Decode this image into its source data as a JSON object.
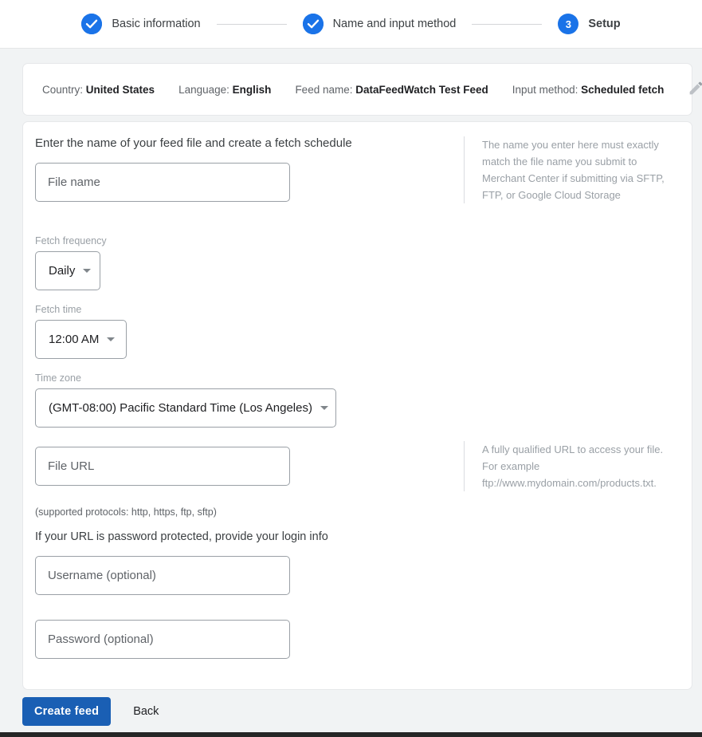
{
  "stepper": {
    "steps": [
      {
        "label": "Basic information",
        "state": "complete",
        "icon": "check-circle-icon",
        "number": "1"
      },
      {
        "label": "Name and input method",
        "state": "complete",
        "icon": "check-circle-icon",
        "number": "2"
      },
      {
        "label": "Setup",
        "state": "active",
        "icon": "number-badge",
        "number": "3"
      }
    ],
    "accent_color": "#1a73e8"
  },
  "summary": {
    "items": [
      {
        "label": "Country:",
        "value": "United States"
      },
      {
        "label": "Language:",
        "value": "English"
      },
      {
        "label": "Feed name:",
        "value": "DataFeedWatch Test Feed"
      },
      {
        "label": "Input method:",
        "value": "Scheduled fetch"
      }
    ],
    "edit_icon": "pencil-icon"
  },
  "form": {
    "title": "Enter the name of your feed file and create a fetch schedule",
    "file_name": {
      "placeholder": "File name",
      "value": ""
    },
    "file_name_hint": "The name you enter here must exactly match the file name you submit to Merchant Center if submitting via SFTP, FTP, or Google Cloud Storage",
    "fetch_frequency": {
      "label": "Fetch frequency",
      "value": "Daily"
    },
    "fetch_time": {
      "label": "Fetch time",
      "value": "12:00 AM"
    },
    "time_zone": {
      "label": "Time zone",
      "value": "(GMT-08:00) Pacific Standard Time (Los Angeles)"
    },
    "file_url": {
      "placeholder": "File URL",
      "value": ""
    },
    "file_url_hint": "A fully qualified URL to access your file. For example ftp://www.mydomain.com/products.txt.",
    "protocols_note": "(supported protocols: http, https, ftp, sftp)",
    "login_title": "If your URL is password protected, provide your login info",
    "username": {
      "placeholder": "Username (optional)",
      "value": ""
    },
    "password": {
      "placeholder": "Password (optional)",
      "value": ""
    }
  },
  "footer": {
    "primary_label": "Create feed",
    "secondary_label": "Back",
    "primary_color": "#1a5fb4"
  }
}
